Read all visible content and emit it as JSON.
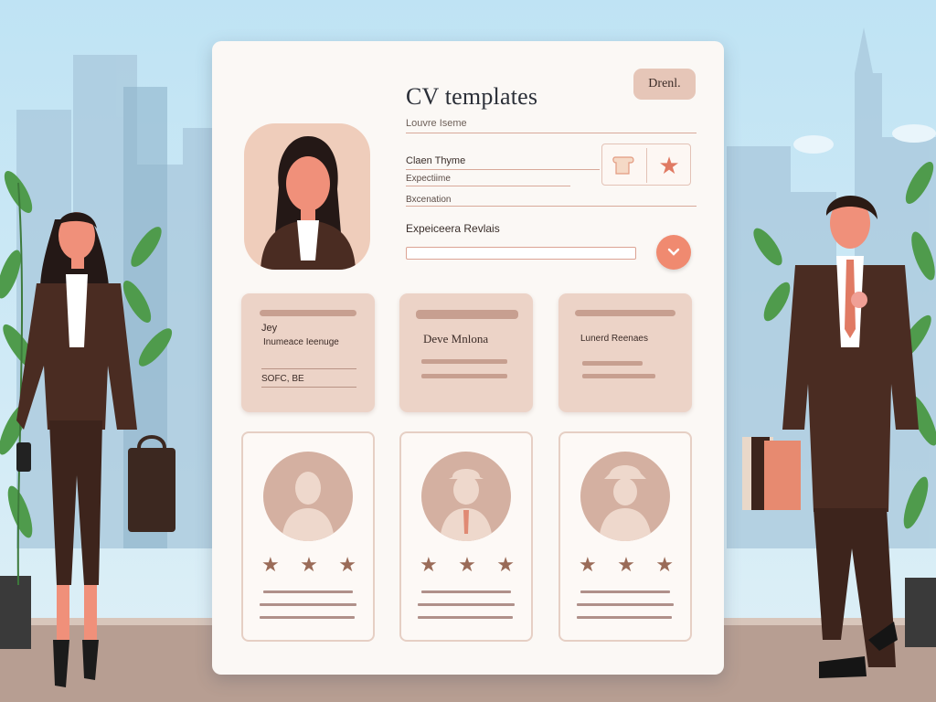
{
  "card": {
    "title": "CV templates",
    "subtitle": "Louvre Iseme",
    "brand_button": "Drenl.",
    "fields": {
      "field1": "Claen Thyme",
      "field2": "Expectiime",
      "field3": "Bxcenation"
    },
    "section_heading": "Expeiceera Revlais",
    "icons": {
      "left": "scroll-icon",
      "right": "star-icon"
    }
  },
  "tiles": [
    {
      "line1": "Jey",
      "line2": "Inumeace Ieenuge",
      "line3": "SOFC, BE"
    },
    {
      "heading": "Deve Mnlona"
    },
    {
      "heading": "Lunerd Reenaes"
    }
  ],
  "profiles": [
    {
      "stars": [
        "★",
        "★",
        "★"
      ],
      "avatar": "person-silhouette"
    },
    {
      "stars": [
        "★",
        "★",
        "★"
      ],
      "avatar": "person-with-cap"
    },
    {
      "stars": [
        "★",
        "★",
        "★"
      ],
      "avatar": "person-with-hat"
    }
  ],
  "colors": {
    "accent": "#f08a70",
    "card": "#fbf8f5",
    "tile": "#ecd3c7",
    "suit": "#4a2c22"
  }
}
